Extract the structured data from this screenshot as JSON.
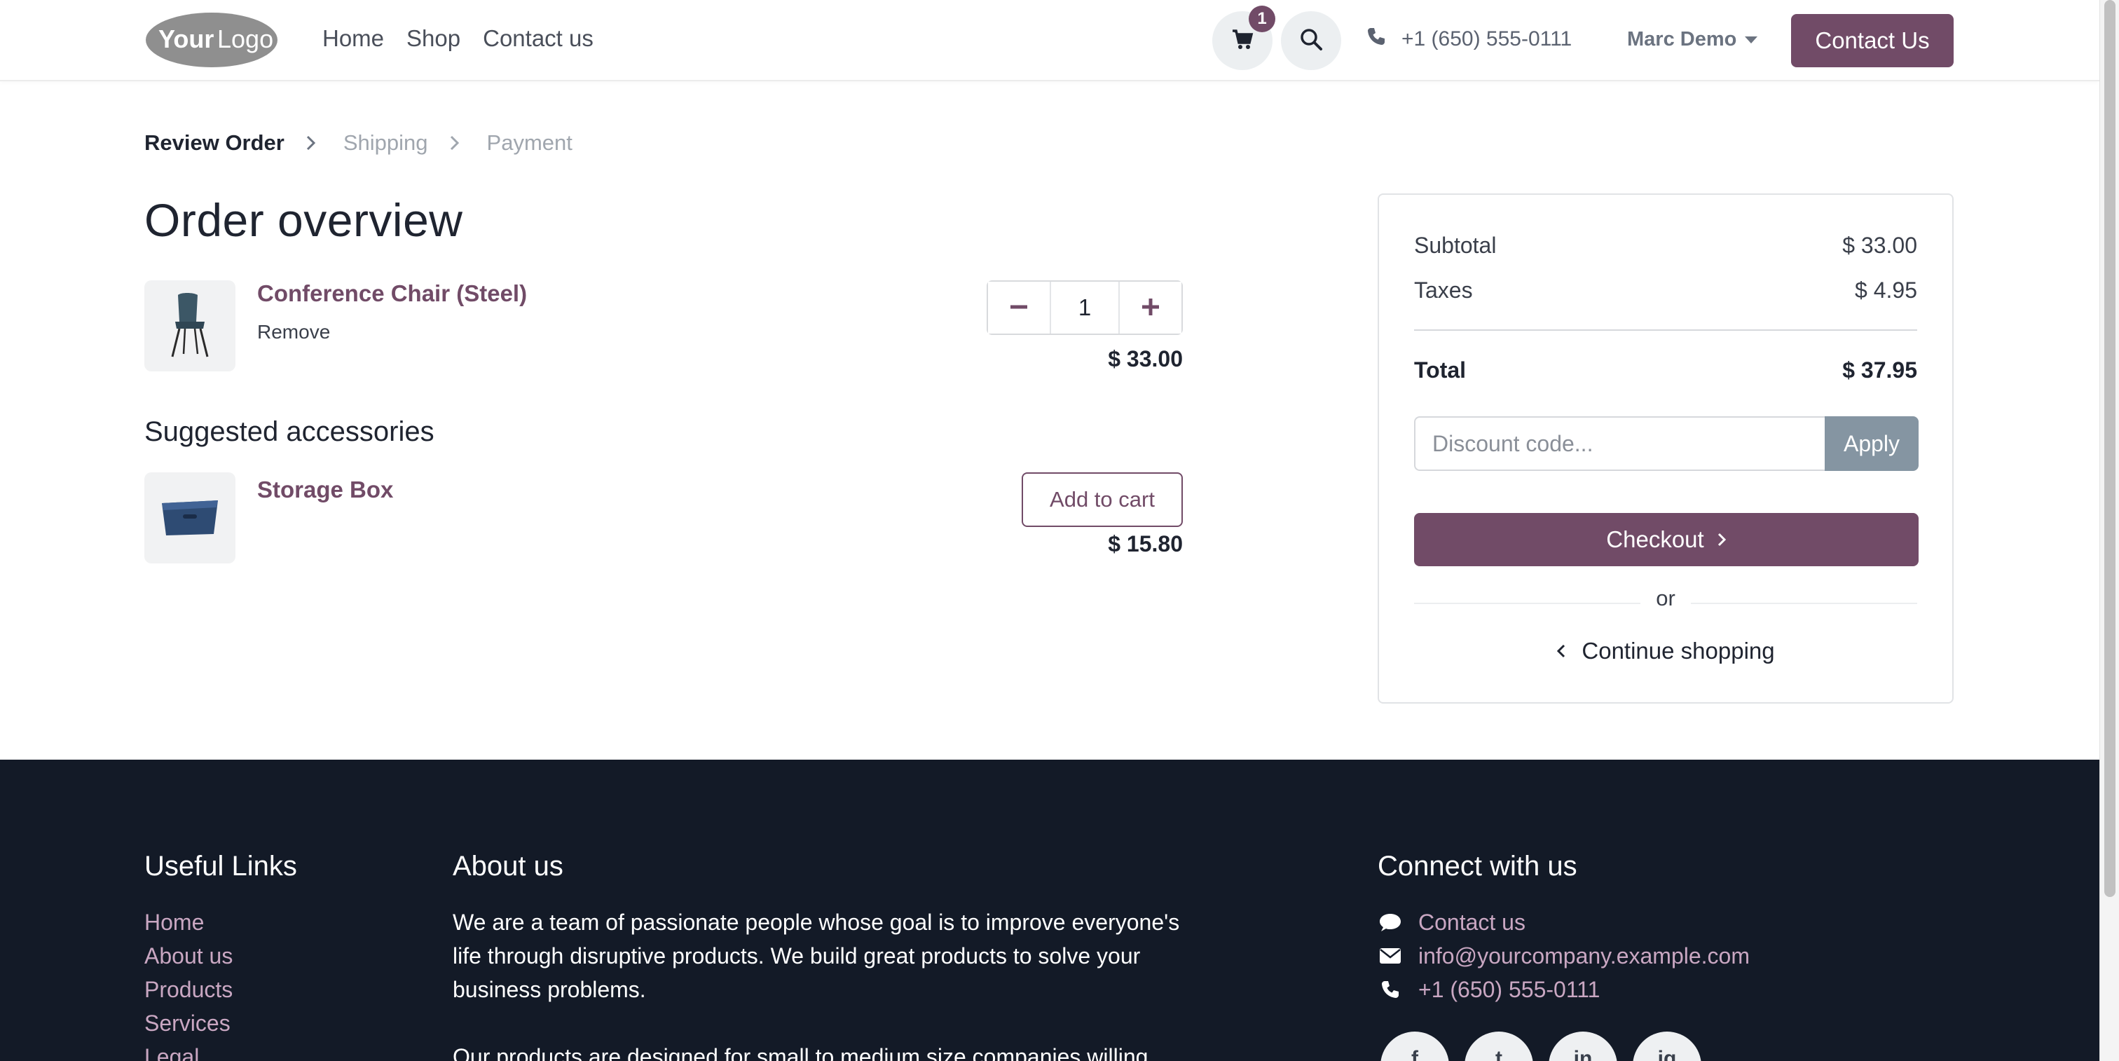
{
  "brand": {
    "logo_text": "YourLogo",
    "accent": "#714b67"
  },
  "header": {
    "nav": [
      "Home",
      "Shop",
      "Contact us"
    ],
    "cart_count": "1",
    "phone": "+1 (650) 555-0111",
    "user": "Marc Demo",
    "cta": "Contact Us"
  },
  "steps": [
    "Review Order",
    "Shipping",
    "Payment"
  ],
  "page_title": "Order overview",
  "cart": {
    "items": [
      {
        "name": "Conference Chair (Steel)",
        "remove": "Remove",
        "quantity": "1",
        "price": "$ 33.00",
        "icon": "chair-icon"
      }
    ]
  },
  "accessories": {
    "title": "Suggested accessories",
    "items": [
      {
        "name": "Storage Box",
        "action": "Add to cart",
        "price": "$ 15.80",
        "icon": "storage-box-icon"
      }
    ]
  },
  "summary": {
    "subtotal_label": "Subtotal",
    "subtotal": "$ 33.00",
    "taxes_label": "Taxes",
    "taxes": "$ 4.95",
    "total_label": "Total",
    "total": "$ 37.95",
    "discount_placeholder": "Discount code...",
    "apply": "Apply",
    "checkout": "Checkout",
    "or": "or",
    "continue": "Continue shopping"
  },
  "footer": {
    "useful_links_title": "Useful Links",
    "useful_links": [
      "Home",
      "About us",
      "Products",
      "Services",
      "Legal"
    ],
    "about_title": "About us",
    "about_p1": "We are a team of passionate people whose goal is to improve everyone's life through disruptive products. We build great products to solve your business problems.",
    "about_p2": "Our products are designed for small to medium size companies willing",
    "connect_title": "Connect with us",
    "connect": [
      {
        "label": "Contact us",
        "icon": "comment-icon"
      },
      {
        "label": "info@yourcompany.example.com",
        "icon": "envelope-icon"
      },
      {
        "label": "+1 (650) 555-0111",
        "icon": "phone-icon"
      }
    ],
    "socials": [
      {
        "glyph": "f",
        "icon": "facebook-icon"
      },
      {
        "glyph": "t",
        "icon": "twitter-icon"
      },
      {
        "glyph": "in",
        "icon": "linkedin-icon"
      },
      {
        "glyph": "ig",
        "icon": "instagram-icon"
      }
    ]
  }
}
